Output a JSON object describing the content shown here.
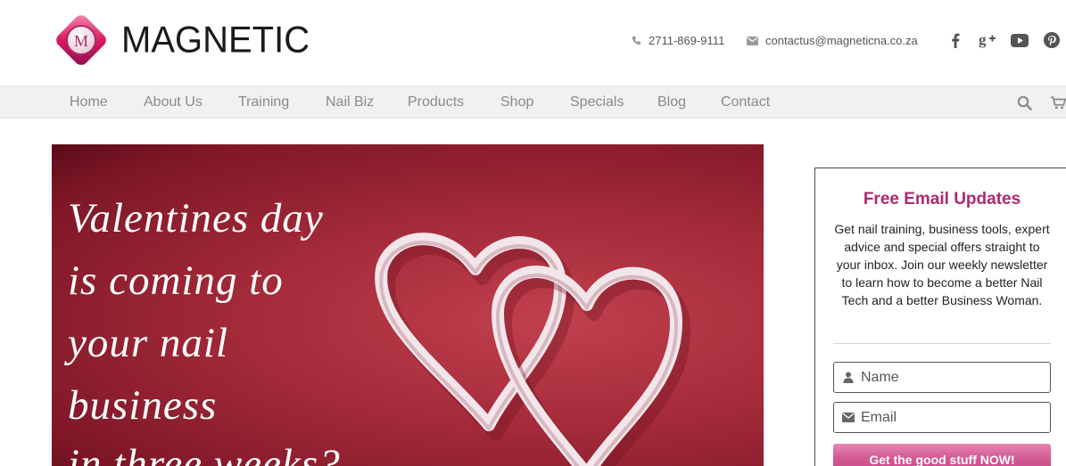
{
  "brand": {
    "name": "MAGNETIC",
    "mark_letter": "M",
    "color": "#c2185b"
  },
  "contact": {
    "phone": "2711-869-9111",
    "email": "contactus@magneticna.co.za"
  },
  "social": [
    "facebook-icon",
    "google-plus-icon",
    "youtube-icon",
    "pinterest-icon"
  ],
  "nav": {
    "items": [
      "Home",
      "About Us",
      "Training",
      "Nail Biz",
      "Products",
      "Shop",
      "Specials",
      "Blog",
      "Contact"
    ],
    "icons": [
      "search-icon",
      "cart-icon"
    ]
  },
  "hero": {
    "lines": [
      "Valentines day",
      "is coming to",
      "your nail",
      "business",
      "in three weeks?"
    ],
    "background": "#a62c3b"
  },
  "signup": {
    "title": "Free Email Updates",
    "description": "Get nail training, business tools, expert advice and special offers straight to your inbox. Join our weekly newsletter to learn how to become a better Nail Tech and a better Business Woman.",
    "name_placeholder": "Name",
    "email_placeholder": "Email",
    "button": "Get the good stuff NOW!",
    "accent": "#b0286e",
    "button_color": "#d35b94"
  }
}
